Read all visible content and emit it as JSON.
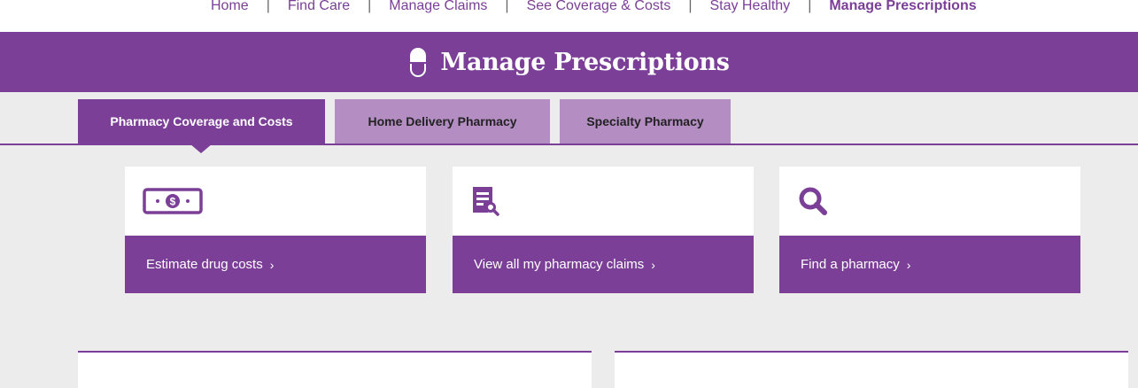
{
  "top_nav": {
    "items": [
      {
        "label": "Home"
      },
      {
        "label": "Find Care"
      },
      {
        "label": "Manage Claims"
      },
      {
        "label": "See Coverage & Costs"
      },
      {
        "label": "Stay Healthy"
      },
      {
        "label": "Manage Prescriptions"
      }
    ],
    "active_index": 5
  },
  "banner": {
    "title": "Manage Prescriptions",
    "icon": "pill-capsule-icon"
  },
  "tabs": [
    {
      "label": "Pharmacy Coverage and Costs",
      "active": true
    },
    {
      "label": "Home Delivery Pharmacy",
      "active": false
    },
    {
      "label": "Specialty Pharmacy",
      "active": false
    }
  ],
  "cards": [
    {
      "label": "Estimate drug costs",
      "icon": "money-bill-icon"
    },
    {
      "label": "View all my pharmacy claims",
      "icon": "claims-document-icon"
    },
    {
      "label": "Find a pharmacy",
      "icon": "search-icon"
    }
  ],
  "colors": {
    "brand_purple": "#7b3f98",
    "tab_inactive": "#b48dc3",
    "background": "#ececec"
  }
}
